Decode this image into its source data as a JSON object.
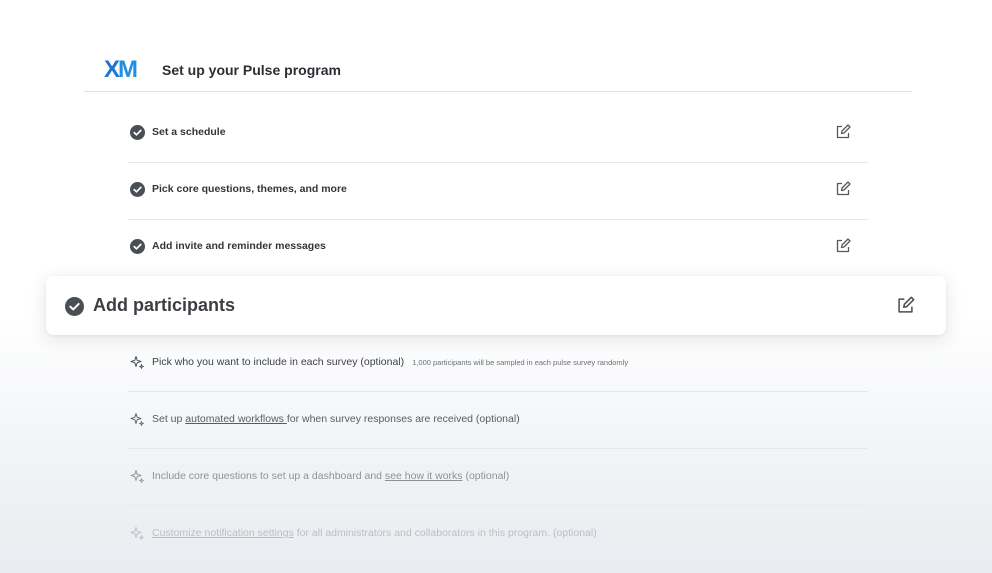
{
  "header": {
    "logo_x": "X",
    "logo_m": "M",
    "title": "Set up your Pulse program"
  },
  "steps": [
    {
      "label": "Set a schedule"
    },
    {
      "label": "Pick core questions, themes, and more"
    },
    {
      "label": "Add invite and reminder messages"
    }
  ],
  "highlighted_step": {
    "label": "Add participants"
  },
  "optional_steps": [
    {
      "text": "Pick who you want to include in each survey (optional)",
      "note": "1,000 participants will be sampled in each pulse survey randomly"
    },
    {
      "prefix": "Set up ",
      "link": "automated workflows ",
      "suffix": "for when survey responses are received (optional)"
    },
    {
      "prefix": "Include core questions to set up a dashboard and ",
      "link": "see how it works",
      "suffix": " (optional)"
    },
    {
      "link": "Customize notification settings",
      "suffix": " for all administrators and collaborators in this program.  (optional)"
    }
  ],
  "colors": {
    "logo_blue": "#1b76d2",
    "check_dark": "#4a4f55"
  }
}
